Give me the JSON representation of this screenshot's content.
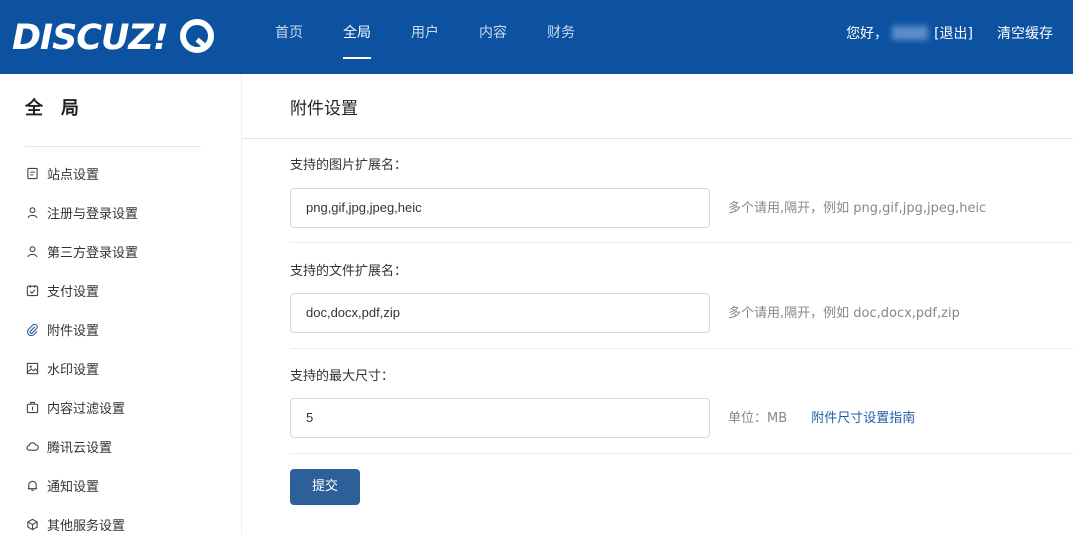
{
  "header": {
    "logo_text": "DISCUZ!Q",
    "nav": [
      {
        "label": "首页",
        "active": false
      },
      {
        "label": "全局",
        "active": true
      },
      {
        "label": "用户",
        "active": false
      },
      {
        "label": "内容",
        "active": false
      },
      {
        "label": "财务",
        "active": false
      }
    ],
    "greeting": "您好，",
    "logout": "[退出]",
    "clear_cache": "清空缓存",
    "bg_color": "#0c52a1"
  },
  "sidebar": {
    "title": "全局",
    "items": [
      {
        "label": "站点设置",
        "icon": "document-icon"
      },
      {
        "label": "注册与登录设置",
        "icon": "user-icon"
      },
      {
        "label": "第三方登录设置",
        "icon": "user-icon"
      },
      {
        "label": "支付设置",
        "icon": "calendar-check-icon"
      },
      {
        "label": "附件设置",
        "icon": "paperclip-icon",
        "active": true
      },
      {
        "label": "水印设置",
        "icon": "image-icon"
      },
      {
        "label": "内容过滤设置",
        "icon": "filter-box-icon"
      },
      {
        "label": "腾讯云设置",
        "icon": "cloud-icon"
      },
      {
        "label": "通知设置",
        "icon": "bell-icon"
      },
      {
        "label": "其他服务设置",
        "icon": "cube-icon"
      }
    ]
  },
  "main": {
    "title": "附件设置",
    "fields": [
      {
        "label": "支持的图片扩展名：",
        "value": "png,gif,jpg,jpeg,heic",
        "hint": "多个请用,隔开，例如 png,gif,jpg,jpeg,heic"
      },
      {
        "label": "支持的文件扩展名：",
        "value": "doc,docx,pdf,zip",
        "hint": "多个请用,隔开，例如 doc,docx,pdf,zip"
      },
      {
        "label": "支持的最大尺寸：",
        "value": "5",
        "hint": "单位：MB",
        "link": "附件尺寸设置指南"
      }
    ],
    "submit": "提交"
  }
}
